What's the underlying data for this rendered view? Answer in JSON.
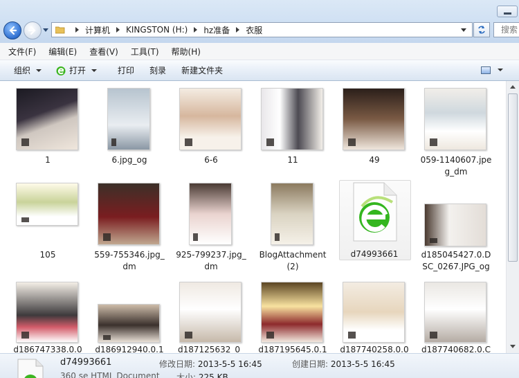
{
  "address": {
    "crumbs": [
      "计算机",
      "KINGSTON (H:)",
      "hz准备",
      "衣服"
    ],
    "search_placeholder": "搜索"
  },
  "menu": [
    "文件(F)",
    "编辑(E)",
    "查看(V)",
    "工具(T)",
    "帮助(H)"
  ],
  "toolbar": {
    "organize": "组织",
    "open": "打开",
    "print": "打印",
    "burn": "刻录",
    "new_folder": "新建文件夹"
  },
  "files": [
    {
      "name": "1",
      "kind": "night-gown"
    },
    {
      "name": "6.jpg_og",
      "kind": "window-portrait"
    },
    {
      "name": "6-6",
      "kind": "cream-couple"
    },
    {
      "name": "11",
      "kind": "gown-curtain"
    },
    {
      "name": "49",
      "kind": "sofa-couple"
    },
    {
      "name": "059-1140607.jpeg_dm",
      "kind": "window-gown"
    },
    {
      "name": "105",
      "kind": "garden-couple"
    },
    {
      "name": "559-755346.jpg_dm",
      "kind": "red-dress"
    },
    {
      "name": "925-799237.jpg_dm",
      "kind": "pink-portrait"
    },
    {
      "name": "BlogAttachment (2)",
      "kind": "mirror-selfie"
    },
    {
      "name": "d74993661",
      "kind": "html-ie"
    },
    {
      "name": "d185045427.0.DSC_0267.JPG_og",
      "kind": "white-shirt"
    },
    {
      "name": "d186747338.0.0",
      "kind": "flower-couple"
    },
    {
      "name": "d186912940.0.1",
      "kind": "studio-couple"
    },
    {
      "name": "d187125632_0_",
      "kind": "lace-gown"
    },
    {
      "name": "d187195645.0.1",
      "kind": "arch-windows"
    },
    {
      "name": "d187740258.0.0",
      "kind": "white-gown"
    },
    {
      "name": "d187740682.0.C",
      "kind": "gown-interior"
    }
  ],
  "details": {
    "name": "d74993661",
    "type": "360 se HTML Document",
    "modified_label": "修改日期:",
    "modified": "2013-5-5 16:45",
    "created_label": "创建日期:",
    "created": "2013-5-5 16:45",
    "size_label": "大小:",
    "size": "225 KB"
  }
}
